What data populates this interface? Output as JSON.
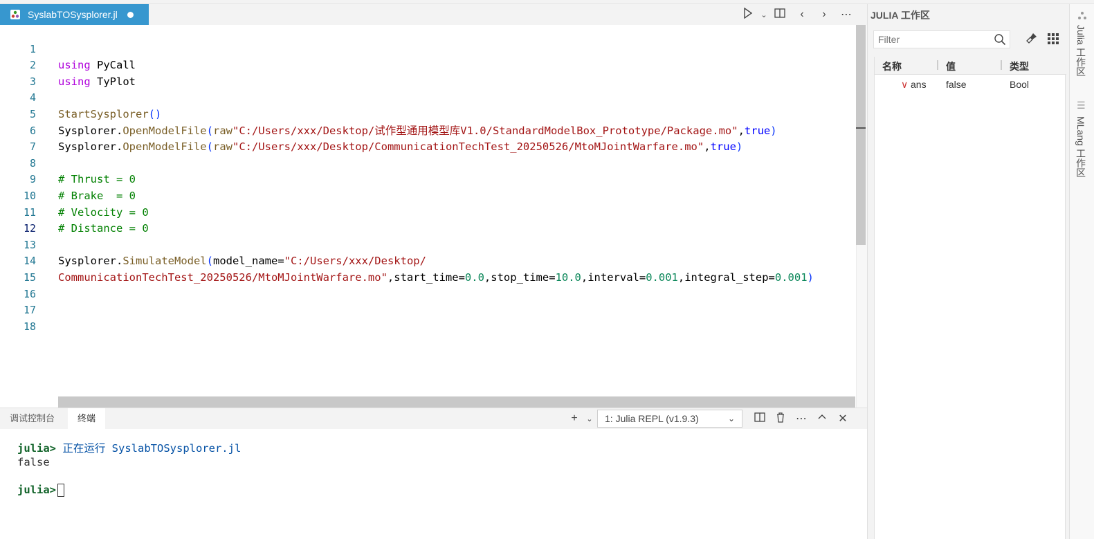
{
  "editor": {
    "tab_title": "SyslabTOSysplorer.jl",
    "file_icon": "julia-file-icon",
    "toolbar_icons": [
      "run-icon",
      "chevron-down-icon",
      "split-editor-icon",
      "back-icon",
      "forward-icon",
      "more-icon"
    ],
    "lines": [
      {
        "n": "1"
      },
      {
        "n": "2"
      },
      {
        "n": "3"
      },
      {
        "n": "4"
      },
      {
        "n": "5"
      },
      {
        "n": "6"
      },
      {
        "n": "7"
      },
      {
        "n": "8"
      },
      {
        "n": "9"
      },
      {
        "n": "10"
      },
      {
        "n": "11"
      },
      {
        "n": "12"
      },
      {
        "n": "13"
      },
      {
        "n": "14"
      },
      {
        "n": "15"
      },
      {
        "n": "16"
      },
      {
        "n": "17"
      },
      {
        "n": "18"
      }
    ],
    "code": {
      "l1_kw": "using",
      "l1_rest": " PyCall",
      "l2_kw": "using",
      "l2_rest": " TyPlot",
      "l4_fn": "StartSysplorer",
      "l4_paren": "()",
      "l5_obj": "Sysplorer.",
      "l5_fn": "OpenModelFile",
      "l5_open": "(",
      "l5_raw": "raw",
      "l5_str": "\"C:/Users/xxx/Desktop/试作型通用模型库V1.0/StandardModelBox_Prototype/Package.mo\"",
      "l5_comma": ",",
      "l5_bool": "true",
      "l5_close": ")",
      "l6_obj": "Sysplorer.",
      "l6_fn": "OpenModelFile",
      "l6_open": "(",
      "l6_raw": "raw",
      "l6_str": "\"C:/Users/xxx/Desktop/CommunicationTechTest_20250526/MtoMJointWarfare.mo\"",
      "l6_comma": ",",
      "l6_bool": "true",
      "l6_close": ")",
      "l8": "# Thrust = 0",
      "l9": "# Brake  = 0",
      "l10": "# Velocity = 0",
      "l11": "# Distance = 0",
      "l13_obj": "Sysplorer.",
      "l13_fn": "SimulateModel",
      "l13_open": "(",
      "l13_arg": "model_name=",
      "l13_str": "\"C:/Users/xxx/Desktop/",
      "l14_str": "CommunicationTechTest_20250526/MtoMJointWarfare.mo\"",
      "l14_a1": ",start_time=",
      "l14_v1": "0.0",
      "l14_a2": ",stop_time=",
      "l14_v2": "10.0",
      "l14_a3": ",interval=",
      "l14_v3": "0.001",
      "l14_a4": ",integral_step=",
      "l14_v4": "0.001",
      "l14_close": ")"
    }
  },
  "panel": {
    "tabs": [
      {
        "label": "调试控制台"
      },
      {
        "label": "终端"
      }
    ],
    "terminal_select": "1: Julia REPL (v1.9.3)",
    "tool_icons": [
      "add-terminal-icon",
      "chevron-down-icon",
      "split-terminal-icon",
      "trash-icon",
      "more-icon",
      "maximize-panel-icon",
      "close-panel-icon"
    ],
    "prompt": "julia>",
    "run_msg": " 正在运行 SyslabTOSysplorer.jl",
    "output": "false"
  },
  "workspace": {
    "title": "JULIA 工作区",
    "filter_placeholder": "Filter",
    "columns": [
      "名称",
      "值",
      "类型"
    ],
    "rows": [
      {
        "name": "ans",
        "value": "false",
        "type": "Bool"
      }
    ]
  },
  "side_tabs": [
    "Julia 工作区",
    "MLang 工作区"
  ]
}
